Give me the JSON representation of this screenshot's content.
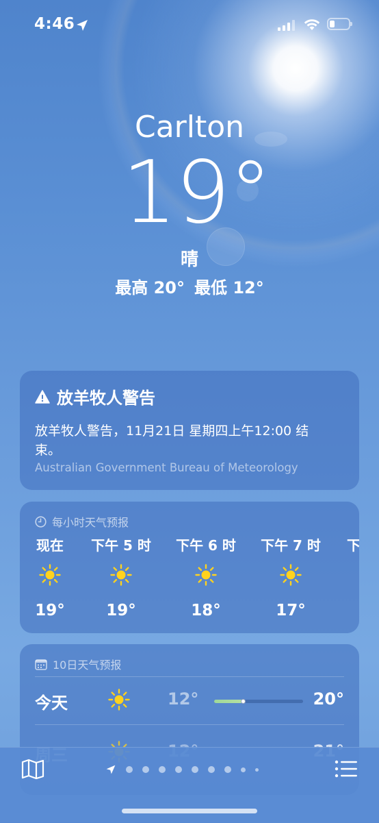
{
  "status_bar": {
    "time": "4:46"
  },
  "current": {
    "city": "Carlton",
    "temperature": "19°",
    "condition": "晴",
    "high": "最高 20°",
    "low": "最低 12°"
  },
  "alert": {
    "title": "放羊牧人警告",
    "body": "放羊牧人警告，11月21日 星期四上午12:00 结束。",
    "source": "Australian Government Bureau of Meteorology"
  },
  "hourly": {
    "header": "每小时天气预报",
    "items": [
      {
        "label": "现在",
        "temp": "19°",
        "icon": "sun-icon"
      },
      {
        "label": "下午 5 时",
        "temp": "19°",
        "icon": "sun-icon"
      },
      {
        "label": "下午 6 时",
        "temp": "18°",
        "icon": "sun-icon"
      },
      {
        "label": "下午 7 时",
        "temp": "17°",
        "icon": "sun-icon"
      },
      {
        "label": "下",
        "temp": "",
        "icon": ""
      }
    ]
  },
  "daily": {
    "header": "10日天气预报",
    "items": [
      {
        "day": "今天",
        "low": "12°",
        "high": "20°",
        "icon": "sun-icon",
        "current_level": 0.2
      },
      {
        "day": "周三",
        "low": "12°",
        "high": "21°",
        "icon": "sun-icon"
      }
    ]
  },
  "toolbar": {
    "map": "map-icon",
    "list": "list-icon",
    "pages": 9
  },
  "colors": {
    "sky_top": "#4f84cc",
    "sky_bottom": "#78a9e2",
    "card": "#406ebe",
    "sun": "#ffd21e",
    "temp_bar": "#9fd89a"
  }
}
